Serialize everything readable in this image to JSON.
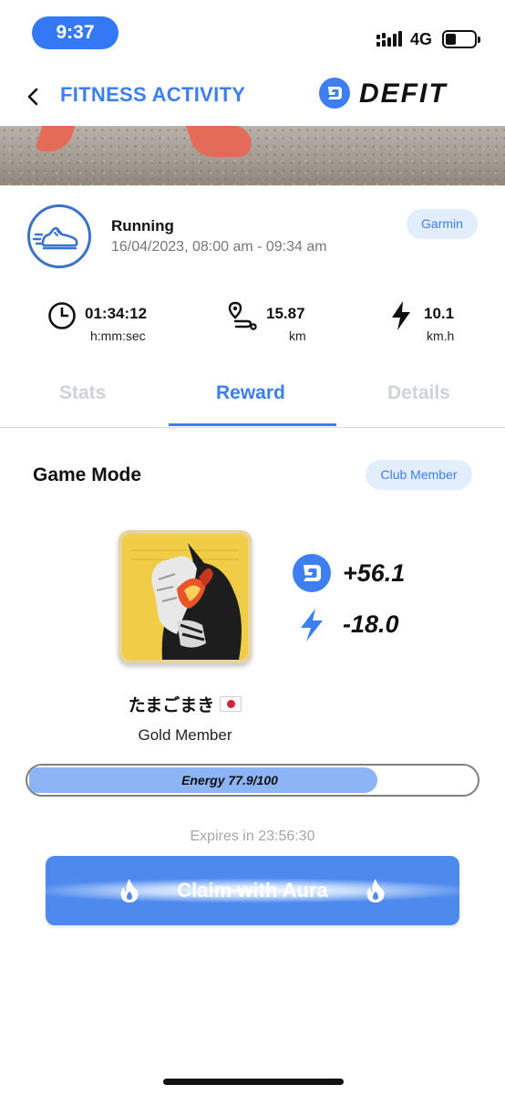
{
  "status_bar": {
    "time": "9:37",
    "network": "4G",
    "battery_level": 0.35
  },
  "header": {
    "back_icon": "chevron-left-icon",
    "title": "FITNESS ACTIVITY",
    "brand_icon": "defit-coin-icon",
    "brand_name": "DEFIT"
  },
  "activity": {
    "type_icon": "running-shoe-icon",
    "name": "Running",
    "datetime": "16/04/2023, 08:00 am - 09:34 am",
    "source": "Garmin",
    "metrics": [
      {
        "icon": "clock-icon",
        "value": "01:34:12",
        "unit": "h:mm:sec"
      },
      {
        "icon": "route-icon",
        "value": "15.87",
        "unit": "km"
      },
      {
        "icon": "lightning-icon",
        "value": "10.1",
        "unit": "km.h"
      }
    ]
  },
  "tabs": [
    {
      "label": "Stats",
      "active": false
    },
    {
      "label": "Reward",
      "active": true
    },
    {
      "label": "Details",
      "active": false
    }
  ],
  "game_mode": {
    "title": "Game Mode",
    "membership_badge": "Club Member",
    "avatar_icon": "anime-avatar",
    "rewards": [
      {
        "icon": "defit-coin-icon",
        "value": "+56.1"
      },
      {
        "icon": "lightning-icon",
        "value": "-18.0"
      }
    ],
    "username": "たまごまき",
    "flag_icon": "japan-flag-icon",
    "member_level": "Gold Member",
    "energy": {
      "label": "Energy 77.9/100",
      "current": 77.9,
      "max": 100
    },
    "expires": "Expires in 23:56:30",
    "claim_button": {
      "label": "Claim with Aura",
      "icon": "flame-icon"
    }
  },
  "colors": {
    "accent": "#3d7ff0",
    "button": "#4e89ee",
    "energy_fill": "#8db5f5",
    "badge_bg": "#e3eefc"
  }
}
